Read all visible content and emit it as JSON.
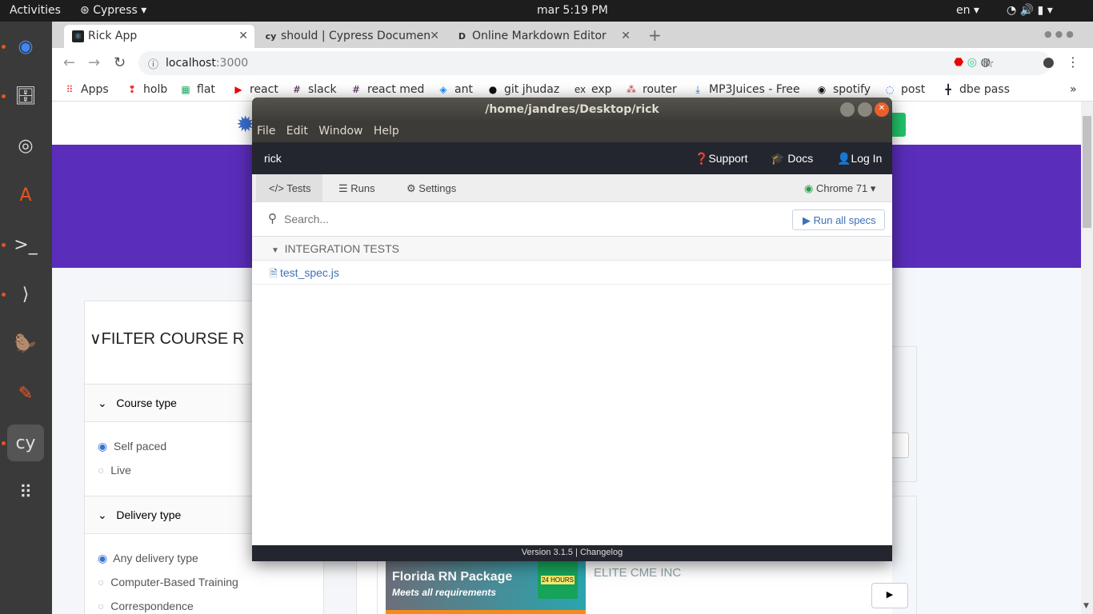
{
  "topbar": {
    "activities": "Activities",
    "app": "Cypress ▾",
    "clock": "mar  5:19 PM",
    "lang": "en ▾"
  },
  "dock": [
    "chrome-icon",
    "files-icon",
    "rhythmbox-icon",
    "software-icon",
    "terminal-icon",
    "vscode-icon",
    "beaver-icon",
    "postman-icon",
    "cypress-icon",
    "apps-grid-icon"
  ],
  "browser": {
    "tabs": [
      {
        "title": "Rick App",
        "icon": "react-icon"
      },
      {
        "title": "should | Cypress Documen",
        "icon": "cy"
      },
      {
        "title": "Online Markdown Editor",
        "icon": "D"
      }
    ],
    "url_host": "localhost",
    "url_port": ":3000",
    "bookmarks": [
      {
        "label": "Apps",
        "icon": "⠿",
        "color": "#e33"
      },
      {
        "label": "holb",
        "icon": "❢",
        "color": "#e33"
      },
      {
        "label": "flat",
        "icon": "▦",
        "color": "#2a6"
      },
      {
        "label": "react",
        "icon": "▶",
        "color": "#e00"
      },
      {
        "label": "slack",
        "icon": "#",
        "color": "#4a154b"
      },
      {
        "label": "react med",
        "icon": "#",
        "color": "#4a154b"
      },
      {
        "label": "ant",
        "icon": "◈",
        "color": "#1890ff"
      },
      {
        "label": "git jhudaz",
        "icon": "●",
        "color": "#111"
      },
      {
        "label": "exp",
        "icon": "ex",
        "color": "#333"
      },
      {
        "label": "router",
        "icon": "⁂",
        "color": "#c33"
      },
      {
        "label": "MP3Juices - Free",
        "icon": "⤓",
        "color": "#1a6fc4"
      },
      {
        "label": "spotify",
        "icon": "◉",
        "color": "#111"
      },
      {
        "label": "post",
        "icon": "◌",
        "color": "#1a73e8"
      },
      {
        "label": "dbe pass",
        "icon": "╋",
        "color": "#223"
      }
    ],
    "more": "»"
  },
  "page": {
    "filter_title": "FILTER COURSE R",
    "course_type": "Course type",
    "course_options": [
      "Self paced",
      "Live"
    ],
    "delivery_type": "Delivery type",
    "delivery_options": [
      "Any delivery type",
      "Computer-Based Training",
      "Correspondence"
    ],
    "provider": "ELITE CME INC",
    "ad_title": "Florida RN Package",
    "ad_sub": "Meets all requirements",
    "ad_badge": "24 HOURS",
    "colors": {
      "purple": "#5a2dbb",
      "green": "#21c56a"
    }
  },
  "cypress": {
    "title": "/home/jandres/Desktop/rick",
    "menu": [
      "File",
      "Edit",
      "Window",
      "Help"
    ],
    "project": "rick",
    "support": "Support",
    "docs": "Docs",
    "login": "Log In",
    "tabs": [
      "Tests",
      "Runs",
      "Settings"
    ],
    "browser": "Chrome 71",
    "search_placeholder": "Search...",
    "run_all": "Run all specs",
    "section": "INTEGRATION TESTS",
    "spec": "test_spec.js",
    "version": "Version 3.1.5",
    "changelog": "Changelog"
  }
}
